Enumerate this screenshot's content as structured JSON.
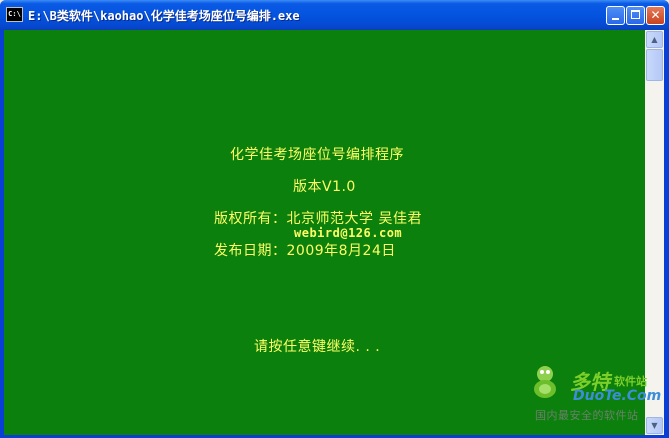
{
  "window": {
    "title": "E:\\B类软件\\kaohao\\化学佳考场座位号编排.exe",
    "icon_label": "C:\\",
    "buttons": {
      "minimize": "",
      "maximize": "",
      "close": "✕"
    }
  },
  "console": {
    "line1": "化学佳考场座位号编排程序",
    "line2": "版本V1.0",
    "line3": "版权所有：北京师范大学 吴佳君",
    "email": "webird@126.com",
    "line4": "发布日期：2009年8月24日",
    "prompt": "请按任意键继续. . ."
  },
  "watermark": {
    "cn_name": "多特",
    "cn_small": "软件站",
    "en_name": "DuoTe.Com",
    "tagline": "国内最安全的软件站"
  },
  "colors": {
    "console_bg": "#0c800c",
    "console_text": "#ffff66",
    "titlebar": "#0454e0"
  }
}
